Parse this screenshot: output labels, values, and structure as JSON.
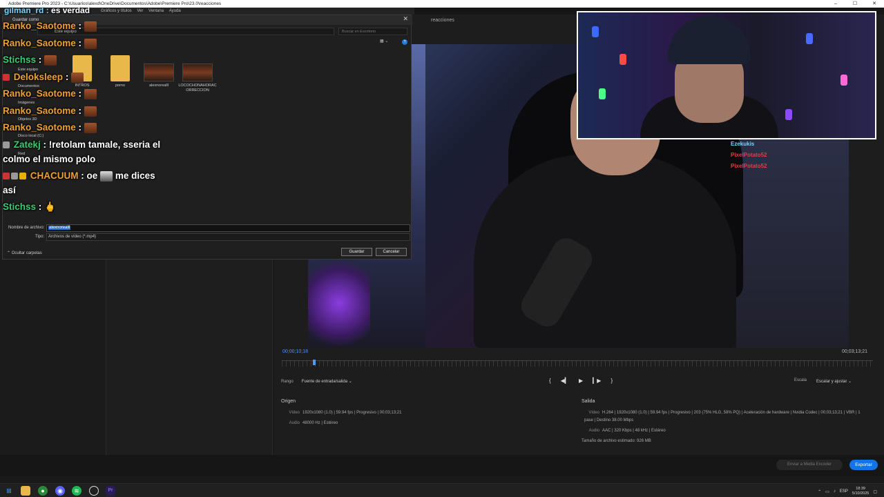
{
  "window": {
    "title": "Adobe Premiere Pro 2023 - C:\\Usuarios\\alexd\\OneDrive\\Documentos\\Adobe\\Premiere Pro\\23.0\\reacciones",
    "menu": [
      "Gráficos y títulos",
      "Ver",
      "Ventana",
      "Ayuda"
    ]
  },
  "export": {
    "tab_name": "reacciones",
    "timecode_current": "00;00;10;18",
    "timecode_total": "00;03;13;21",
    "range_label": "Rango",
    "range_value": "Fuente de entrada/salida",
    "scale_label": "Escala",
    "scale_value": "Escalar y ajustar",
    "origen_title": "Origen",
    "origen_video_label": "Vídeo",
    "origen_video": "1920x1080 (1.0) | 59.94 fps | Progresivo | 00;03;13;21",
    "origen_audio_label": "Audio",
    "origen_audio": "48000 Hz | Estéreo",
    "salida_title": "Salida",
    "salida_video_label": "Vídeo",
    "salida_video": "H.264 | 1920x1080 (1.0) | 59.94 fps | Progresivo | 203 (75% HLG, 58% PQ) | Aceleración de hardware | Nvidia Codec | 00;03;13;21 | VBR | 1 pase | Destino 38.00 Mbps",
    "salida_audio_label": "Audio",
    "salida_audio": "AAC | 320 Kbps | 48 kHz | Estéreo",
    "file_size": "Tamaño de archivo estimado:  926 MB",
    "send_button": "Enviar a Media Encoder",
    "export_button": "Exportar",
    "playhead_fraction": 0.055
  },
  "dialog": {
    "title": "Guardar como",
    "address": "Este equipo",
    "search_placeholder": "Buscar en Escritorio",
    "nav_items": [
      "Este equipo",
      "Documentos",
      "Imágenes",
      "Objetos 3D",
      "Disco local (C:)",
      "Red"
    ],
    "files": [
      {
        "name": "INTROS",
        "kind": "folder"
      },
      {
        "name": "porno",
        "kind": "folder"
      },
      {
        "name": "alexnorealll",
        "kind": "video"
      },
      {
        "name": "LOCOCHONAHORACORRECCION",
        "kind": "video"
      }
    ],
    "filename_label": "Nombre de archivo:",
    "filename_value": "alexnorealll",
    "type_label": "Tipo:",
    "type_value": "Archivos de vídeo (*.mp4)",
    "hide_folders": "Ocultar carpetas",
    "save_button": "Guardar",
    "cancel_button": "Cancelar"
  },
  "chat": {
    "watermark_user": "gilman_rd",
    "watermark_text": "es verdad",
    "messages": [
      {
        "user": "Ranko_Saotome",
        "text": ""
      },
      {
        "user": "Ranko_Saotome",
        "text": ""
      },
      {
        "user": "Stichss",
        "text": ""
      },
      {
        "user": "Deloksleep",
        "text": ""
      },
      {
        "user": "Ranko_Saotome",
        "text": ""
      },
      {
        "user": "Ranko_Saotome",
        "text": ""
      },
      {
        "user": "Ranko_Saotome",
        "text": ""
      },
      {
        "user": "Zatekj",
        "text": "!retolam tamale, sseria el"
      },
      {
        "user": "",
        "text": "colmo el mismo polo"
      },
      {
        "user": "CHACUUM",
        "text": "oe"
      },
      {
        "user": "",
        "text": "me dices"
      },
      {
        "user": "",
        "text": "así"
      },
      {
        "user": "Stichss",
        "text": ""
      }
    ],
    "overlay_users": [
      "Ezekukis",
      "PixelPotato52",
      "PixelPotato52"
    ]
  },
  "taskbar": {
    "lang": "ESP",
    "time": "18:39",
    "date": "5/10/2025"
  },
  "colors": {
    "accent": "#1473e6",
    "timecode": "#4a9aff",
    "chat_orange": "#f0a030",
    "chat_green": "#3ccc70"
  }
}
